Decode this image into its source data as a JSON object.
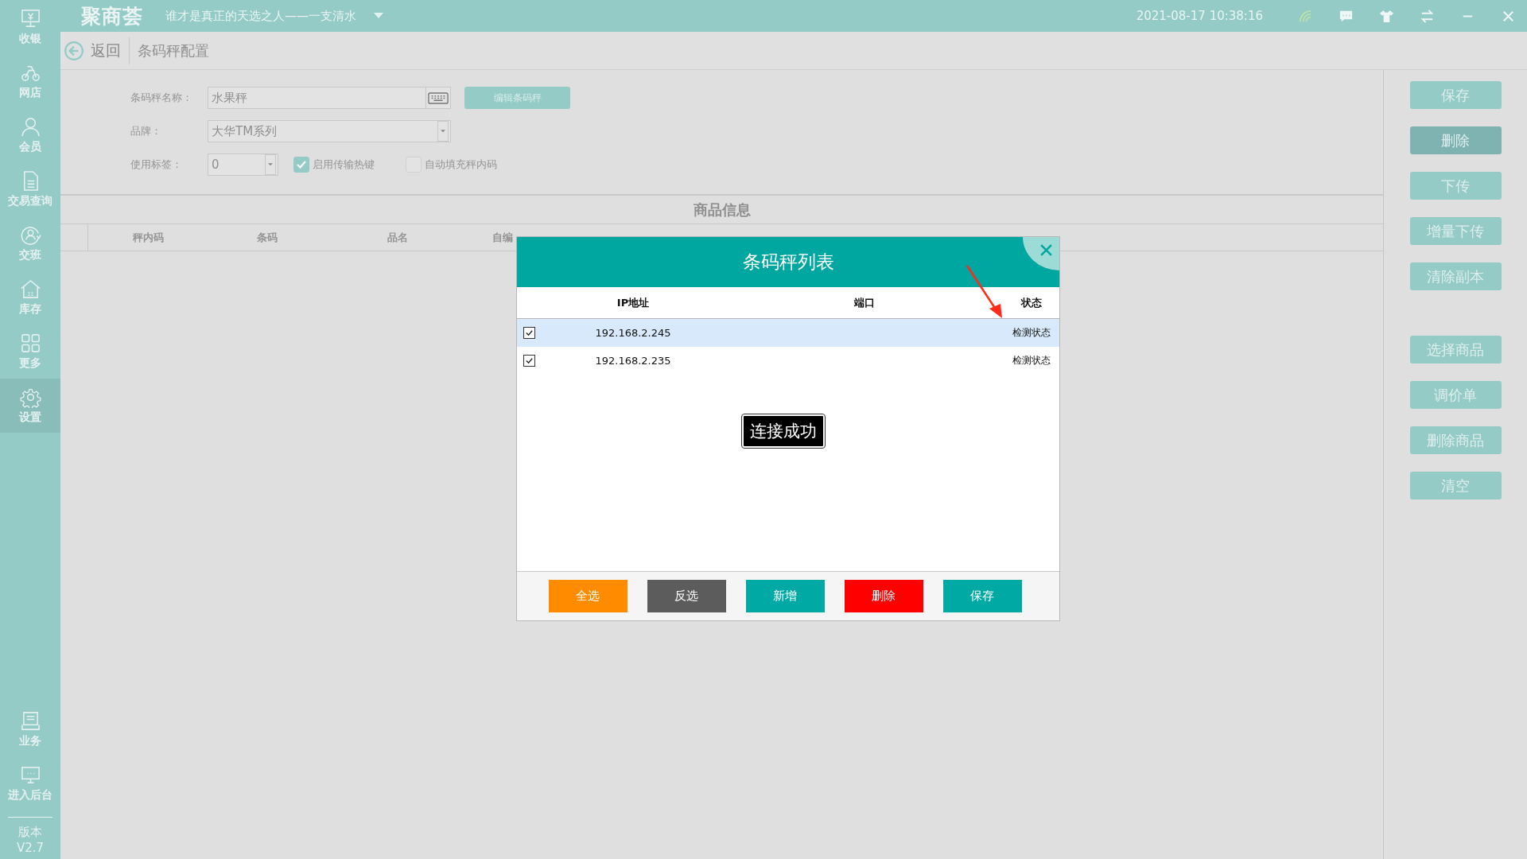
{
  "top_bar": {
    "logo": "聚商荟",
    "slogan": "谁才是真正的天选之人——一支清水",
    "datetime": "2021-08-17 10:38:16"
  },
  "sidebar": {
    "items": [
      {
        "label": "收银",
        "kind": "register",
        "selected": false
      },
      {
        "label": "网店",
        "kind": "bike",
        "selected": false
      },
      {
        "label": "会员",
        "kind": "person",
        "selected": false
      },
      {
        "label": "交易查询",
        "kind": "document",
        "selected": false
      },
      {
        "label": "交班",
        "kind": "handover",
        "selected": false
      },
      {
        "label": "库存",
        "kind": "warehouse",
        "selected": false
      },
      {
        "label": "更多",
        "kind": "grid",
        "selected": false
      },
      {
        "label": "设置",
        "kind": "settings",
        "selected": true
      }
    ],
    "bottom_items": [
      {
        "label": "业务",
        "kind": "business"
      },
      {
        "label": "进入后台",
        "kind": "monitor"
      }
    ],
    "version_label": "版本",
    "version": "V2.7"
  },
  "header": {
    "back": "返回",
    "title": "条码秤配置"
  },
  "form": {
    "name_label": "条码秤名称：",
    "name_value": "水果秤",
    "edit_button": "编辑条码秤",
    "brand_label": "品牌：",
    "brand_value": "大华TM系列",
    "tag_label": "使用标签：",
    "tag_value": "0",
    "checkboxes": [
      {
        "label": "启用传输热键",
        "checked": true
      },
      {
        "label": "自动填充秤内码",
        "checked": false
      }
    ]
  },
  "table": {
    "title": "商品信息",
    "columns": [
      "秤内码",
      "条码",
      "品名",
      "自编"
    ]
  },
  "actions": [
    {
      "label": "保存",
      "hovered": false
    },
    {
      "label": "删除",
      "hovered": true
    },
    {
      "label": "下传",
      "hovered": false
    },
    {
      "label": "增量下传",
      "hovered": false
    },
    {
      "label": "清除副本",
      "hovered": false
    }
  ],
  "item_actions": [
    {
      "label": "选择商品",
      "hovered": false
    },
    {
      "label": "调价单",
      "hovered": false
    },
    {
      "label": "删除商品",
      "hovered": false
    },
    {
      "label": "清空",
      "hovered": false
    }
  ],
  "dialog": {
    "title": "条码秤列表",
    "columns": [
      "IP地址",
      "端口",
      "状态"
    ],
    "rows": [
      {
        "checked": true,
        "selected": true,
        "ip": "192.168.2.245",
        "status": "检测状态"
      },
      {
        "checked": true,
        "selected": false,
        "ip": "192.168.2.235",
        "status": "检测状态"
      }
    ],
    "toast": "连接成功",
    "buttons": [
      {
        "label": "全选",
        "color": "#ff8c00"
      },
      {
        "label": "反选",
        "color": "#5c5c5c"
      },
      {
        "label": "新增",
        "color": "#00a9a3"
      },
      {
        "label": "删除",
        "color": "#ff0000"
      },
      {
        "label": "保存",
        "color": "#00a9a3"
      }
    ]
  }
}
